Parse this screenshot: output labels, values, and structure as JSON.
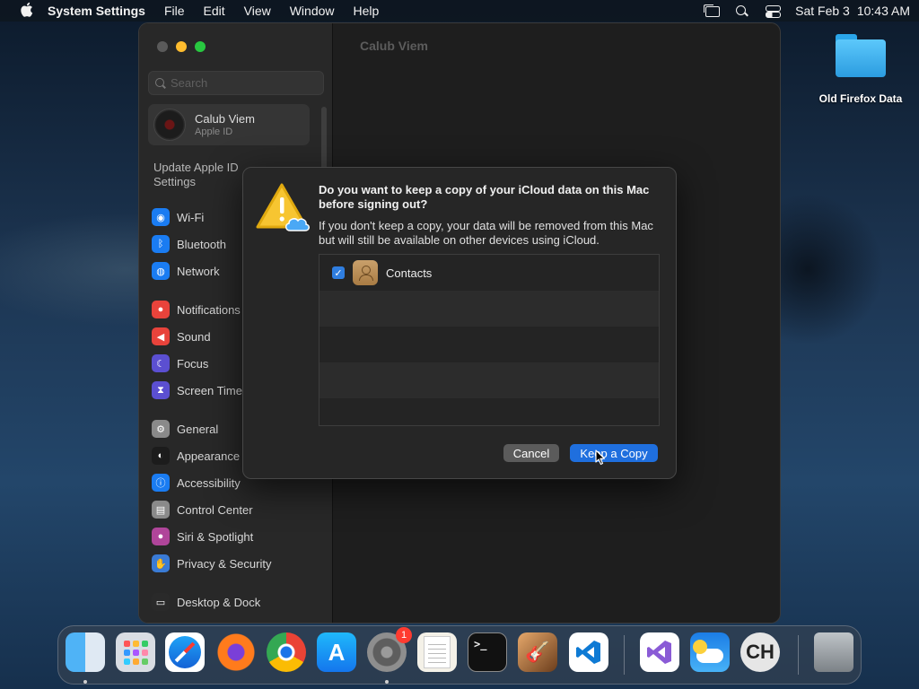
{
  "menubar": {
    "apple_icon": "apple-logo-icon",
    "app_name": "System Settings",
    "menus": [
      "File",
      "Edit",
      "View",
      "Window",
      "Help"
    ],
    "status_icons": [
      "screen-mirroring-icon",
      "spotlight-search-icon",
      "control-center-icon"
    ],
    "date": "Sat Feb 3",
    "time": "10:43 AM"
  },
  "settings_window": {
    "content_title": "Calub Viem",
    "search": {
      "placeholder": "Search",
      "value": ""
    },
    "account": {
      "name": "Calub Viem",
      "subtitle": "Apple ID"
    },
    "update_note": "Update Apple ID Settings",
    "sidebar_items": [
      {
        "label": "Wi-Fi",
        "icon": "wifi-icon",
        "color": "#1a7cf2"
      },
      {
        "label": "Bluetooth",
        "icon": "bluetooth-icon",
        "color": "#1a7cf2"
      },
      {
        "label": "Network",
        "icon": "globe-icon",
        "color": "#1a7cf2"
      },
      {
        "label": "Notifications",
        "icon": "bell-icon",
        "color": "#e8433b"
      },
      {
        "label": "Sound",
        "icon": "speaker-icon",
        "color": "#e8433b"
      },
      {
        "label": "Focus",
        "icon": "moon-icon",
        "color": "#5b4fd1"
      },
      {
        "label": "Screen Time",
        "icon": "hourglass-icon",
        "color": "#5b4fd1"
      },
      {
        "label": "General",
        "icon": "gear-icon",
        "color": "#8a8a8a"
      },
      {
        "label": "Appearance",
        "icon": "appearance-icon",
        "color": "#1c1c1c"
      },
      {
        "label": "Accessibility",
        "icon": "accessibility-icon",
        "color": "#1a7cf2"
      },
      {
        "label": "Control Center",
        "icon": "control-center-icon",
        "color": "#8a8a8a"
      },
      {
        "label": "Siri & Spotlight",
        "icon": "siri-icon",
        "color": "#b0459a"
      },
      {
        "label": "Privacy & Security",
        "icon": "hand-icon",
        "color": "#3a7bd5"
      },
      {
        "label": "Desktop & Dock",
        "icon": "dock-icon",
        "color": "#2a2a2a"
      }
    ]
  },
  "dialog": {
    "title": "Do you want to keep a copy of your iCloud data on this Mac before signing out?",
    "body": "If you don't keep a copy, your data will be removed from this Mac but will still be available on other devices using iCloud.",
    "icon": "warning-icloud-icon",
    "items": [
      {
        "label": "Contacts",
        "checked": true,
        "icon": "contacts-icon"
      }
    ],
    "cancel_label": "Cancel",
    "keep_label": "Keep a Copy"
  },
  "desktop": {
    "folder_label": "Old Firefox Data",
    "folder_icon": "folder-icon"
  },
  "dock": {
    "apps": [
      {
        "name": "Finder",
        "icon": "finder-icon",
        "running": true
      },
      {
        "name": "Launchpad",
        "icon": "launchpad-icon",
        "running": false
      },
      {
        "name": "Safari",
        "icon": "safari-icon",
        "running": false
      },
      {
        "name": "Firefox",
        "icon": "firefox-icon",
        "running": false
      },
      {
        "name": "Chrome",
        "icon": "chrome-icon",
        "running": false
      },
      {
        "name": "App Store",
        "icon": "app-store-icon",
        "running": false
      },
      {
        "name": "System Settings",
        "icon": "system-settings-icon",
        "running": true,
        "badge": "1"
      },
      {
        "name": "TextEdit",
        "icon": "textedit-icon",
        "running": false
      },
      {
        "name": "Terminal",
        "icon": "terminal-icon",
        "running": false
      },
      {
        "name": "GarageBand",
        "icon": "garageband-icon",
        "running": false
      },
      {
        "name": "Visual Studio Code",
        "icon": "vscode-icon",
        "running": false
      },
      {
        "name": "Visual Studio",
        "icon": "visual-studio-icon",
        "running": false
      },
      {
        "name": "Weather",
        "icon": "weather-icon",
        "running": false
      },
      {
        "name": "CH",
        "icon": "ch-app-icon",
        "running": false
      },
      {
        "name": "Trash",
        "icon": "trash-icon",
        "running": false
      }
    ],
    "terminal_prompt": ">_",
    "ch_text": "CH"
  }
}
